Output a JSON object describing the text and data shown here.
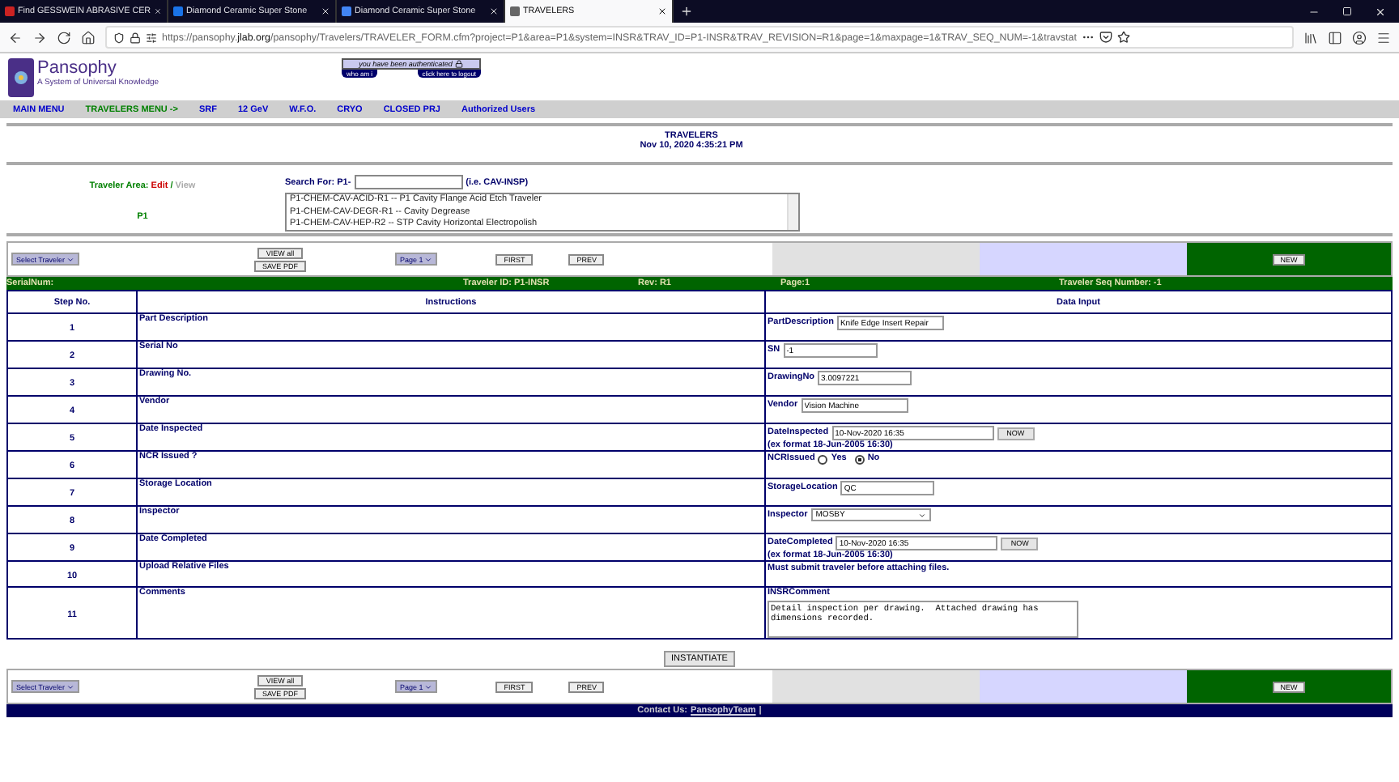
{
  "browser": {
    "tabs": [
      {
        "title": "Find GESSWEIN ABRASIVE CER",
        "selected": false
      },
      {
        "title": "Diamond Ceramic Super Stone",
        "selected": false
      },
      {
        "title": "Diamond Ceramic Super Stone",
        "selected": false
      },
      {
        "title": "TRAVELERS",
        "selected": true
      }
    ],
    "url_prefix": "https://pansophy.",
    "url_domain": "jlab.org",
    "url_rest": "/pansophy/Travelers/TRAVELER_FORM.cfm?project=P1&area=P1&system=INSR&TRAV_ID=P1-INSR&TRAV_REVISION=R1&page=1&maxpage=1&TRAV_SEQ_NUM=-1&travstat"
  },
  "header": {
    "logo_title": "Pansophy",
    "logo_subtitle": "A System of Universal Knowledge",
    "auth_message": "you have been authenticated",
    "who_button": "who am i",
    "logout_button": "click here to logout"
  },
  "menu": [
    {
      "label": "MAIN MENU",
      "color": "#0000cc"
    },
    {
      "label": "TRAVELERS MENU ->",
      "color": "#008000"
    },
    {
      "label": "SRF",
      "color": "#0000cc"
    },
    {
      "label": "12 GeV",
      "color": "#0000cc"
    },
    {
      "label": "W.F.O.",
      "color": "#0000cc"
    },
    {
      "label": "CRYO",
      "color": "#0000cc"
    },
    {
      "label": "CLOSED PRJ",
      "color": "#0000cc"
    },
    {
      "label": "Authorized Users",
      "color": "#0000cc"
    }
  ],
  "title": "TRAVELERS",
  "timestamp": "Nov 10, 2020 4:35:21 PM",
  "area": {
    "label": "Traveler Area:",
    "edit": "Edit",
    "separator": "/",
    "view": "View",
    "project": "P1"
  },
  "search": {
    "label": "Search For: P1-",
    "hint": "(i.e. CAV-INSP)",
    "results": [
      "P1-CHEM-CAV-ACID-R1 -- P1 Cavity Flange Acid Etch Traveler",
      "P1-CHEM-CAV-DEGR-R1 -- Cavity Degrease",
      "P1-CHEM-CAV-HEP-R2 -- STP Cavity Horizontal Electropolish"
    ]
  },
  "toolbar_top": {
    "select": "Select Traveler",
    "view_all": "VIEW all",
    "save_pdf": "SAVE PDF",
    "page": "Page 1",
    "first": "FIRST",
    "prev": "PREV",
    "new": "NEW"
  },
  "info_bar": {
    "serial": "SerialNum:",
    "traveler_id": "Traveler ID: P1-INSR",
    "rev": "Rev: R1",
    "page": "Page:1",
    "seq": "Traveler Seq Number: -1"
  },
  "table": {
    "columns": [
      "Step No.",
      "Instructions",
      "Data Input"
    ],
    "rows": [
      {
        "step": "1",
        "instruction": "Part Description",
        "input": {
          "kind": "text",
          "label": "PartDescription",
          "value": "Knife Edge Insert Repair"
        }
      },
      {
        "step": "2",
        "instruction": "Serial No",
        "input": {
          "kind": "text",
          "label": "SN",
          "value": "-1"
        }
      },
      {
        "step": "3",
        "instruction": "Drawing No.",
        "input": {
          "kind": "text",
          "label": "DrawingNo",
          "value": "3.0097221"
        }
      },
      {
        "step": "4",
        "instruction": "Vendor",
        "input": {
          "kind": "text",
          "label": "Vendor",
          "value": "Vision Machine"
        }
      },
      {
        "step": "5",
        "instruction": "Date Inspected",
        "input": {
          "kind": "datetime",
          "label": "DateInspected",
          "value": "10-Nov-2020 16:35",
          "button": "NOW",
          "note": "(ex format 18-Jun-2005 16:30)"
        }
      },
      {
        "step": "6",
        "instruction": "NCR Issued ?",
        "input": {
          "kind": "radio",
          "label": "NCRIssued",
          "options": [
            {
              "label": "Yes",
              "selected": false
            },
            {
              "label": "No",
              "selected": true
            }
          ]
        }
      },
      {
        "step": "7",
        "instruction": "Storage Location",
        "input": {
          "kind": "text",
          "label": "StorageLocation",
          "value": "QC"
        }
      },
      {
        "step": "8",
        "instruction": "Inspector",
        "input": {
          "kind": "select",
          "label": "Inspector",
          "value": "MOSBY"
        }
      },
      {
        "step": "9",
        "instruction": "Date Completed",
        "input": {
          "kind": "datetime",
          "label": "DateCompleted",
          "value": "10-Nov-2020 16:35",
          "button": "NOW",
          "note": "(ex format 18-Jun-2005 16:30)"
        }
      },
      {
        "step": "10",
        "instruction": "Upload Relative Files",
        "input": {
          "kind": "note",
          "label": "Must submit traveler before attaching files."
        }
      },
      {
        "step": "11",
        "instruction": "Comments",
        "input": {
          "kind": "textarea",
          "label": "INSRComment",
          "value": "Detail inspection per drawing.  Attached drawing has dimensions recorded."
        }
      }
    ]
  },
  "instantiate": "INSTANTIATE",
  "toolbar_bottom": {
    "select": "Select Traveler",
    "view_all": "VIEW all",
    "save_pdf": "SAVE PDF",
    "page": "Page 1",
    "first": "FIRST",
    "prev": "PREV",
    "new": "NEW"
  },
  "footer": {
    "label": "Contact Us:",
    "link": "PansophyTeam",
    "separator": "|"
  }
}
